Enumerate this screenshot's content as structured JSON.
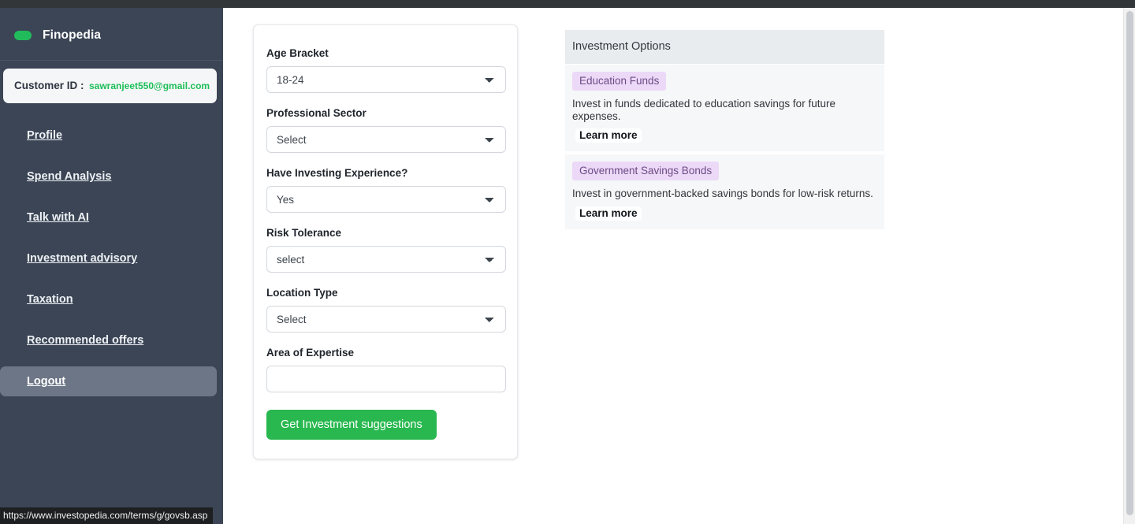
{
  "app": {
    "brand_name": "Finopedia",
    "brand_logo_icon": "green-pill-logo-icon"
  },
  "sidebar": {
    "customer": {
      "label": "Customer ID :",
      "value": "sawranjeet550@gmail.com",
      "value_color": "#1dbf58"
    },
    "items": [
      {
        "label": "Profile",
        "active": false
      },
      {
        "label": "Spend Analysis",
        "active": false
      },
      {
        "label": "Talk with AI",
        "active": false
      },
      {
        "label": "Investment advisory",
        "active": false
      },
      {
        "label": "Taxation",
        "active": false
      },
      {
        "label": "Recommended offers",
        "active": false
      },
      {
        "label": "Logout",
        "active": true
      }
    ],
    "background_color": "#3b4555",
    "active_item_color": "#6d7686"
  },
  "form": {
    "fields": [
      {
        "label": "Age Bracket",
        "type": "select",
        "name": "age-bracket",
        "value": "18-24"
      },
      {
        "label": "Professional Sector",
        "type": "select",
        "name": "professional-sector",
        "value": "Select"
      },
      {
        "label": "Have Investing Experience?",
        "type": "select",
        "name": "investing-experience",
        "value": "Yes"
      },
      {
        "label": "Risk Tolerance",
        "type": "select",
        "name": "risk-tolerance",
        "value": "select"
      },
      {
        "label": "Location Type",
        "type": "select",
        "name": "location-type",
        "value": "Select"
      },
      {
        "label": "Area of Expertise",
        "type": "text",
        "name": "area-of-expertise",
        "value": "",
        "placeholder": ""
      }
    ],
    "submit_label": "Get Investment suggestions",
    "submit_color": "#28b84f"
  },
  "options_panel": {
    "header": "Investment Options",
    "header_bg": "#e9ecef",
    "badge_bg": "#ecd9f7",
    "badge_color": "#6c4b86",
    "cards": [
      {
        "badge": "Education Funds",
        "description": "Invest in funds dedicated to education savings for future expenses.",
        "link_label": "Learn more"
      },
      {
        "badge": "Government Savings Bonds",
        "description": "Invest in government-backed savings bonds for low-risk returns.",
        "link_label": "Learn more"
      }
    ]
  },
  "status_bar": {
    "url": "https://www.investopedia.com/terms/g/govsb.asp"
  }
}
